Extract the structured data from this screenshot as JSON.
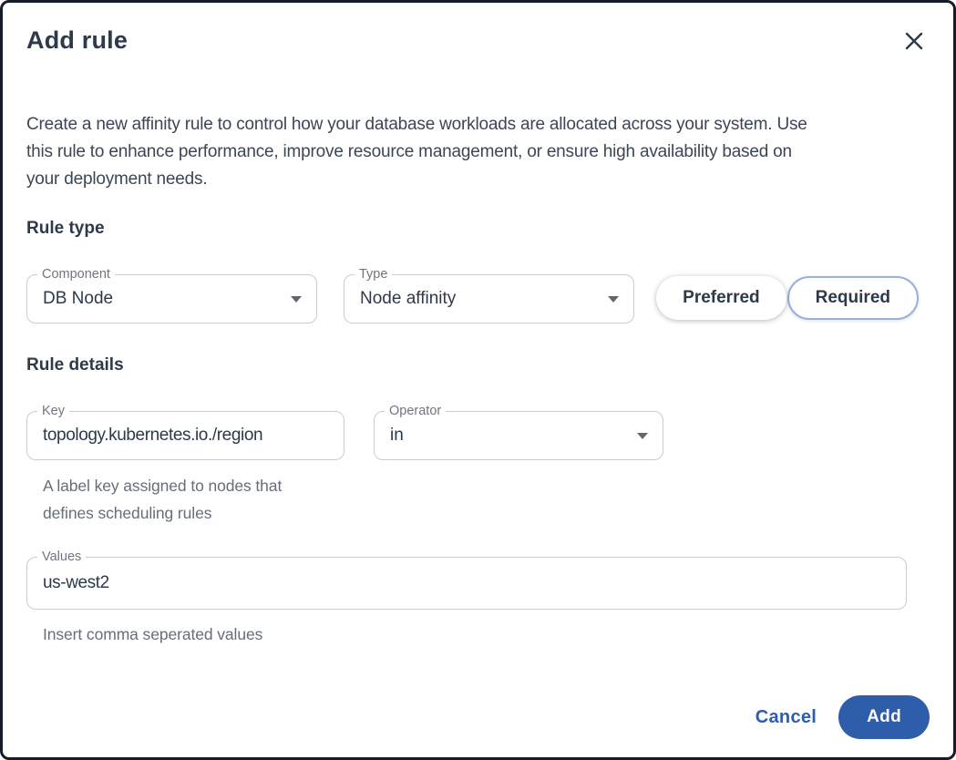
{
  "dialog": {
    "title": "Add rule",
    "description": "Create a new affinity rule to control how your database workloads are allocated across your system. Use\nthis rule to enhance performance, improve resource management, or ensure high availability based on\nyour deployment needs."
  },
  "rule_type": {
    "heading": "Rule type",
    "component_select": {
      "label": "Component",
      "value": "DB Node"
    },
    "type_select": {
      "label": "Type",
      "value": "Node affinity"
    },
    "mode_toggle": {
      "options": [
        {
          "label": "Preferred",
          "selected": false
        },
        {
          "label": "Required",
          "selected": true
        }
      ]
    }
  },
  "rule_details": {
    "heading": "Rule details",
    "key_field": {
      "label": "Key",
      "value": "topology.kubernetes.io./region",
      "helper": "A label key assigned to nodes that\ndefines scheduling rules"
    },
    "operator_select": {
      "label": "Operator",
      "value": "in"
    },
    "values_field": {
      "label": "Values",
      "value": "us-west2",
      "helper": "Insert comma seperated values"
    }
  },
  "footer": {
    "cancel_label": "Cancel",
    "add_label": "Add"
  },
  "colors": {
    "primary_blue": "#2e5ea9",
    "selected_toggle_border": "#9ab1de",
    "text_dark": "#2e3949",
    "label_gray": "#70757e",
    "helper_gray": "#676e79",
    "field_border": "#c9ccd2",
    "frame_border": "#161c27"
  }
}
